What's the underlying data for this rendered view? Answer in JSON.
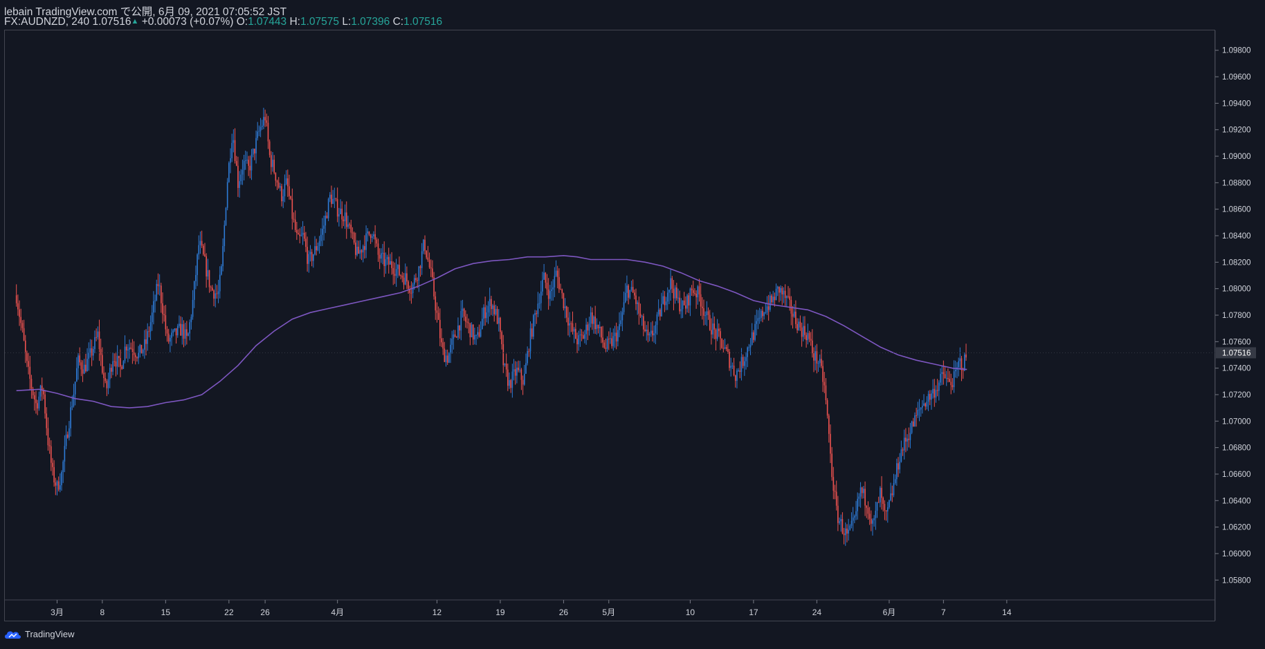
{
  "header": {
    "publish_line": "lebain TradingView.com で公開, 6月 09, 2021 07:05:52 JST",
    "symbol_line": "FX:AUDNZD, 240 1.07516",
    "change": "+0.00073 (+0.07%)",
    "open_label": "O:",
    "open_value": "1.07443",
    "high_label": "H:",
    "high_value": "1.07575",
    "low_label": "L:",
    "low_value": "1.07396",
    "close_label": "C:",
    "close_value": "1.07516"
  },
  "footer": {
    "brand": "TradingView"
  },
  "colors": {
    "background": "#131722",
    "up": "#2e7bd6",
    "down": "#ef5350",
    "ma": "#7e57c2",
    "text": "#d1d4dc",
    "last_price_bg": "#363a45"
  },
  "chart_data": {
    "type": "candlestick",
    "symbol": "FX:AUDNZD",
    "timeframe": "240",
    "y_range": [
      1.0565,
      1.0995
    ],
    "y_ticks": [
      "1.05800",
      "1.06000",
      "1.06200",
      "1.06400",
      "1.06600",
      "1.06800",
      "1.07000",
      "1.07200",
      "1.07400",
      "1.07600",
      "1.07800",
      "1.08000",
      "1.08200",
      "1.08400",
      "1.08600",
      "1.08800",
      "1.09000",
      "1.09200",
      "1.09400",
      "1.09600",
      "1.09800"
    ],
    "x_ticks": [
      {
        "label": "3月",
        "day": 0
      },
      {
        "label": "8",
        "day": 5
      },
      {
        "label": "15",
        "day": 12
      },
      {
        "label": "22",
        "day": 19
      },
      {
        "label": "26",
        "day": 23
      },
      {
        "label": "4月",
        "day": 31
      },
      {
        "label": "12",
        "day": 42
      },
      {
        "label": "19",
        "day": 49
      },
      {
        "label": "26",
        "day": 56
      },
      {
        "label": "5月",
        "day": 61
      },
      {
        "label": "10",
        "day": 70
      },
      {
        "label": "17",
        "day": 77
      },
      {
        "label": "24",
        "day": 84
      },
      {
        "label": "6月",
        "day": 92
      },
      {
        "label": "7",
        "day": 98
      },
      {
        "label": "14",
        "day": 105
      }
    ],
    "last_price": "1.07516",
    "price_path": [
      [
        -4.5,
        1.0795
      ],
      [
        -3.8,
        1.0765
      ],
      [
        -3.3,
        1.074
      ],
      [
        -2.8,
        1.0725
      ],
      [
        -2.3,
        1.0712
      ],
      [
        -1.6,
        1.0727
      ],
      [
        -1.0,
        1.0685
      ],
      [
        -0.5,
        1.066
      ],
      [
        0.0,
        1.065
      ],
      [
        0.5,
        1.066
      ],
      [
        1.2,
        1.0695
      ],
      [
        1.8,
        1.072
      ],
      [
        2.3,
        1.0745
      ],
      [
        3.0,
        1.074
      ],
      [
        3.7,
        1.075
      ],
      [
        4.5,
        1.0765
      ],
      [
        5.0,
        1.074
      ],
      [
        5.4,
        1.0722
      ],
      [
        6.2,
        1.075
      ],
      [
        7.0,
        1.074
      ],
      [
        7.6,
        1.0758
      ],
      [
        8.4,
        1.0755
      ],
      [
        9.0,
        1.075
      ],
      [
        9.8,
        1.0758
      ],
      [
        10.5,
        1.078
      ],
      [
        11.2,
        1.0805
      ],
      [
        11.8,
        1.078
      ],
      [
        12.2,
        1.076
      ],
      [
        13.0,
        1.0765
      ],
      [
        13.8,
        1.077
      ],
      [
        14.4,
        1.076
      ],
      [
        15.0,
        1.079
      ],
      [
        15.7,
        1.0835
      ],
      [
        16.3,
        1.082
      ],
      [
        17.0,
        1.08
      ],
      [
        17.8,
        1.0795
      ],
      [
        18.2,
        1.0815
      ],
      [
        18.8,
        1.088
      ],
      [
        19.4,
        1.092
      ],
      [
        20.0,
        1.088
      ],
      [
        20.6,
        1.0895
      ],
      [
        21.2,
        1.089
      ],
      [
        21.8,
        1.0905
      ],
      [
        22.4,
        1.092
      ],
      [
        23.0,
        1.093
      ],
      [
        23.5,
        1.09
      ],
      [
        24.2,
        1.0885
      ],
      [
        24.8,
        1.087
      ],
      [
        25.4,
        1.088
      ],
      [
        26.0,
        1.0855
      ],
      [
        26.6,
        1.0835
      ],
      [
        27.2,
        1.084
      ],
      [
        27.8,
        1.082
      ],
      [
        28.6,
        1.083
      ],
      [
        29.4,
        1.0845
      ],
      [
        30.2,
        1.087
      ],
      [
        31.0,
        1.086
      ],
      [
        31.8,
        1.0855
      ],
      [
        32.5,
        1.084
      ],
      [
        33.2,
        1.0825
      ],
      [
        34.0,
        1.0835
      ],
      [
        34.8,
        1.0845
      ],
      [
        35.5,
        1.0825
      ],
      [
        36.2,
        1.082
      ],
      [
        37.0,
        1.0818
      ],
      [
        37.8,
        1.0812
      ],
      [
        38.5,
        1.0808
      ],
      [
        39.2,
        1.08
      ],
      [
        40.0,
        1.0815
      ],
      [
        40.6,
        1.0835
      ],
      [
        41.4,
        1.0808
      ],
      [
        42.0,
        1.078
      ],
      [
        42.6,
        1.0752
      ],
      [
        43.2,
        1.0748
      ],
      [
        44.0,
        1.0765
      ],
      [
        44.8,
        1.078
      ],
      [
        45.6,
        1.077
      ],
      [
        46.4,
        1.076
      ],
      [
        47.2,
        1.0782
      ],
      [
        48.0,
        1.079
      ],
      [
        48.8,
        1.0775
      ],
      [
        49.4,
        1.074
      ],
      [
        50.0,
        1.0728
      ],
      [
        50.8,
        1.0738
      ],
      [
        51.6,
        1.073
      ],
      [
        52.2,
        1.076
      ],
      [
        53.0,
        1.0785
      ],
      [
        53.8,
        1.0808
      ],
      [
        54.5,
        1.0795
      ],
      [
        55.2,
        1.0812
      ],
      [
        56.0,
        1.079
      ],
      [
        56.8,
        1.077
      ],
      [
        57.6,
        1.076
      ],
      [
        58.3,
        1.0765
      ],
      [
        59.0,
        1.078
      ],
      [
        59.8,
        1.077
      ],
      [
        60.6,
        1.0755
      ],
      [
        61.4,
        1.076
      ],
      [
        62.2,
        1.077
      ],
      [
        63.0,
        1.08
      ],
      [
        63.8,
        1.0795
      ],
      [
        64.6,
        1.0775
      ],
      [
        65.4,
        1.076
      ],
      [
        66.2,
        1.0772
      ],
      [
        67.0,
        1.079
      ],
      [
        67.8,
        1.0805
      ],
      [
        68.6,
        1.079
      ],
      [
        69.4,
        1.0785
      ],
      [
        70.2,
        1.08
      ],
      [
        71.0,
        1.0795
      ],
      [
        71.8,
        1.0778
      ],
      [
        72.6,
        1.0768
      ],
      [
        73.4,
        1.076
      ],
      [
        74.2,
        1.0748
      ],
      [
        75.0,
        1.0735
      ],
      [
        75.8,
        1.0745
      ],
      [
        76.6,
        1.076
      ],
      [
        77.4,
        1.0772
      ],
      [
        78.2,
        1.0785
      ],
      [
        79.0,
        1.079
      ],
      [
        79.8,
        1.08
      ],
      [
        80.6,
        1.0792
      ],
      [
        81.4,
        1.078
      ],
      [
        82.2,
        1.077
      ],
      [
        83.0,
        1.0765
      ],
      [
        83.6,
        1.075
      ],
      [
        84.2,
        1.0745
      ],
      [
        84.8,
        1.0728
      ],
      [
        85.2,
        1.07
      ],
      [
        85.6,
        1.0665
      ],
      [
        86.2,
        1.063
      ],
      [
        86.8,
        1.062
      ],
      [
        87.4,
        1.0612
      ],
      [
        88.2,
        1.0625
      ],
      [
        88.8,
        1.0648
      ],
      [
        89.6,
        1.0638
      ],
      [
        90.2,
        1.062
      ],
      [
        91.0,
        1.0645
      ],
      [
        91.6,
        1.0625
      ],
      [
        92.4,
        1.0648
      ],
      [
        93.2,
        1.0675
      ],
      [
        94.0,
        1.0688
      ],
      [
        94.8,
        1.07
      ],
      [
        95.6,
        1.0712
      ],
      [
        96.4,
        1.0718
      ],
      [
        97.2,
        1.0725
      ],
      [
        98.0,
        1.0735
      ],
      [
        98.6,
        1.0728
      ],
      [
        99.2,
        1.0732
      ],
      [
        99.8,
        1.0745
      ],
      [
        100.2,
        1.0742
      ],
      [
        100.6,
        1.0752
      ]
    ],
    "moving_average": [
      [
        -4.5,
        1.0723
      ],
      [
        -2.0,
        1.0724
      ],
      [
        0.0,
        1.0721
      ],
      [
        2.0,
        1.0717
      ],
      [
        4.0,
        1.0715
      ],
      [
        6.0,
        1.0711
      ],
      [
        8.0,
        1.071
      ],
      [
        10.0,
        1.0711
      ],
      [
        12.0,
        1.0714
      ],
      [
        14.0,
        1.0716
      ],
      [
        16.0,
        1.072
      ],
      [
        18.0,
        1.073
      ],
      [
        20.0,
        1.0742
      ],
      [
        22.0,
        1.0757
      ],
      [
        24.0,
        1.0768
      ],
      [
        26.0,
        1.0777
      ],
      [
        28.0,
        1.0782
      ],
      [
        30.0,
        1.0785
      ],
      [
        32.0,
        1.0788
      ],
      [
        34.0,
        1.0791
      ],
      [
        36.0,
        1.0794
      ],
      [
        38.0,
        1.0797
      ],
      [
        40.0,
        1.0802
      ],
      [
        42.0,
        1.0808
      ],
      [
        44.0,
        1.0815
      ],
      [
        46.0,
        1.0819
      ],
      [
        48.0,
        1.0821
      ],
      [
        50.0,
        1.0822
      ],
      [
        52.0,
        1.0824
      ],
      [
        54.0,
        1.0824
      ],
      [
        56.0,
        1.0825
      ],
      [
        57.5,
        1.0824
      ],
      [
        59.0,
        1.0822
      ],
      [
        61.0,
        1.0822
      ],
      [
        63.0,
        1.0822
      ],
      [
        65.0,
        1.082
      ],
      [
        67.0,
        1.0817
      ],
      [
        69.0,
        1.0812
      ],
      [
        71.0,
        1.0806
      ],
      [
        73.0,
        1.0802
      ],
      [
        75.0,
        1.0797
      ],
      [
        77.0,
        1.0791
      ],
      [
        79.0,
        1.0788
      ],
      [
        81.0,
        1.0786
      ],
      [
        83.0,
        1.0784
      ],
      [
        85.0,
        1.0779
      ],
      [
        87.0,
        1.0772
      ],
      [
        89.0,
        1.0764
      ],
      [
        91.0,
        1.0756
      ],
      [
        93.0,
        1.075
      ],
      [
        95.0,
        1.0746
      ],
      [
        97.0,
        1.0743
      ],
      [
        99.0,
        1.074
      ],
      [
        100.6,
        1.0739
      ]
    ]
  }
}
